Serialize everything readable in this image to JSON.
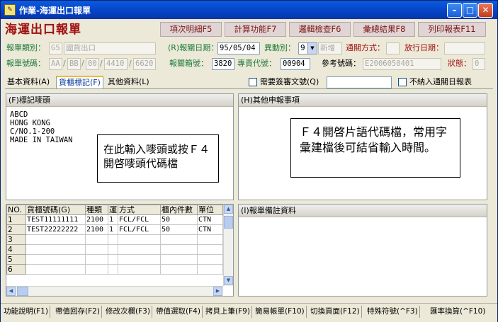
{
  "window": {
    "title": "作業-海運出口報單"
  },
  "heading": "海運出口報單",
  "function_buttons": [
    "項次明細F5",
    "計算功能F7",
    "邏輯檢查F6",
    "彙總結果F8",
    "列印報表F11"
  ],
  "form": {
    "declaration_type_label": "報單類別：",
    "declaration_type_code": "G5",
    "declaration_type_name": "國貨出口",
    "declaration_date_label": "(R)報關日期：",
    "declaration_date": "95/05/04",
    "change_label": "異動別：",
    "change_value": "9",
    "new_label": "新增",
    "clearance_method_label": "通關方式：",
    "release_date_label": "放行日期：",
    "declaration_no_label": "報單號碼：",
    "declaration_no_parts": [
      "AA",
      "BB",
      "00",
      "4410",
      "6620"
    ],
    "box_no_label": "報關箱號：",
    "box_no": "3820",
    "responsible_code_label": "專責代號：",
    "responsible_code": "00904",
    "reference_no_label": "參考號碼：",
    "reference_no": "E2006050401",
    "status_label": "狀態：",
    "status_value": "0"
  },
  "tabs": [
    "基本資料(A)",
    "貨櫃標記(F)",
    "其他資料(L)"
  ],
  "checkboxes": {
    "review_docs": "需要簽審文號(Q)",
    "exclude_daily": "不納入通關日報表"
  },
  "marks_panel": {
    "title": "(F)標記嘜頭",
    "lines": [
      "ABCD",
      "HONG KONG",
      "C/NO.1-200",
      "MADE IN TAIWAN"
    ],
    "hint": "在此輸入嘜頭或按Ｆ４開啓嘜頭代碼檔"
  },
  "other_panel": {
    "title": "(H)其他申報事項",
    "hint": "Ｆ４開啓片語代碼檔，常用字彙建檔後可結省輸入時間。"
  },
  "notes_panel": {
    "title": "(I)報單備註資料"
  },
  "container_grid": {
    "headers": [
      "NO.",
      "貨櫃號碼(G)",
      "種類",
      "運",
      "方式",
      "櫃內件數",
      "單位"
    ],
    "rows": [
      [
        "1",
        "TEST11111111",
        "2100",
        "1",
        "FCL/FCL",
        "50",
        "CTN"
      ],
      [
        "2",
        "TEST22222222",
        "2100",
        "1",
        "FCL/FCL",
        "50",
        "CTN"
      ],
      [
        "3",
        "",
        "",
        "",
        "",
        "",
        ""
      ],
      [
        "4",
        "",
        "",
        "",
        "",
        "",
        ""
      ],
      [
        "5",
        "",
        "",
        "",
        "",
        "",
        ""
      ],
      [
        "6",
        "",
        "",
        "",
        "",
        "",
        ""
      ]
    ]
  },
  "status_bar": [
    "功能說明(F1)",
    "帶值回存(F2)",
    "修改次欄(F3)",
    "帶值選取(F4)",
    "拷貝上筆(F9)",
    "簡易帳單(F10)",
    "切換頁面(F12)",
    "特殊符號(^F3)",
    "匯率換算(^F10)"
  ]
}
